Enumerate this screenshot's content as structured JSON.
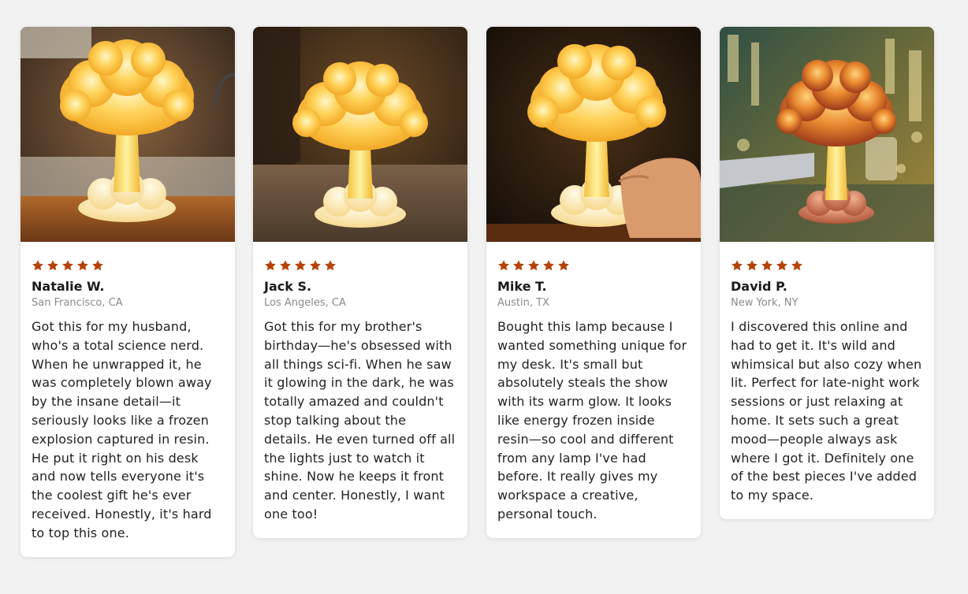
{
  "colors": {
    "star": "#b64207",
    "background": "#f2f2f2",
    "card": "#ffffff"
  },
  "reviews": [
    {
      "rating": 5,
      "name": "Natalie W.",
      "location": "San Francisco, CA",
      "text": "Got this for my husband, who's a total science nerd. When he unwrapped it, he was completely blown away by the insane detail—it seriously looks like a frozen explosion captured in resin. He put it right on his desk and now tells everyone it's the coolest gift he's ever received. Honestly, it's hard to top this one.",
      "image": "mushroom-cloud-lamp-on-kitchen-counter"
    },
    {
      "rating": 5,
      "name": "Jack S.",
      "location": "Los Angeles, CA",
      "text": "Got this for my brother's birthday—he's obsessed with all things sci-fi. When he saw it glowing in the dark, he was totally amazed and couldn't stop talking about the details. He even turned off all the lights just to watch it shine. Now he keeps it front and center. Honestly, I want one too!",
      "image": "mushroom-cloud-lamp-on-carpet"
    },
    {
      "rating": 5,
      "name": "Mike T.",
      "location": "Austin, TX",
      "text": "Bought this lamp because I wanted something unique for my desk. It's small but absolutely steals the show with its warm glow. It looks like energy frozen inside resin—so cool and different from any lamp I've had before. It really gives my workspace a creative, personal touch.",
      "image": "mushroom-cloud-lamp-held-in-hand"
    },
    {
      "rating": 5,
      "name": "David P.",
      "location": "New York, NY",
      "text": "I discovered this online and had to get it. It's wild and whimsical but also cozy when lit. Perfect for late-night work sessions or just relaxing at home. It sets such a great mood—people always ask where I got it. Definitely one of the best pieces I've added to my space.",
      "image": "mushroom-cloud-lamp-on-glass-desk"
    }
  ]
}
